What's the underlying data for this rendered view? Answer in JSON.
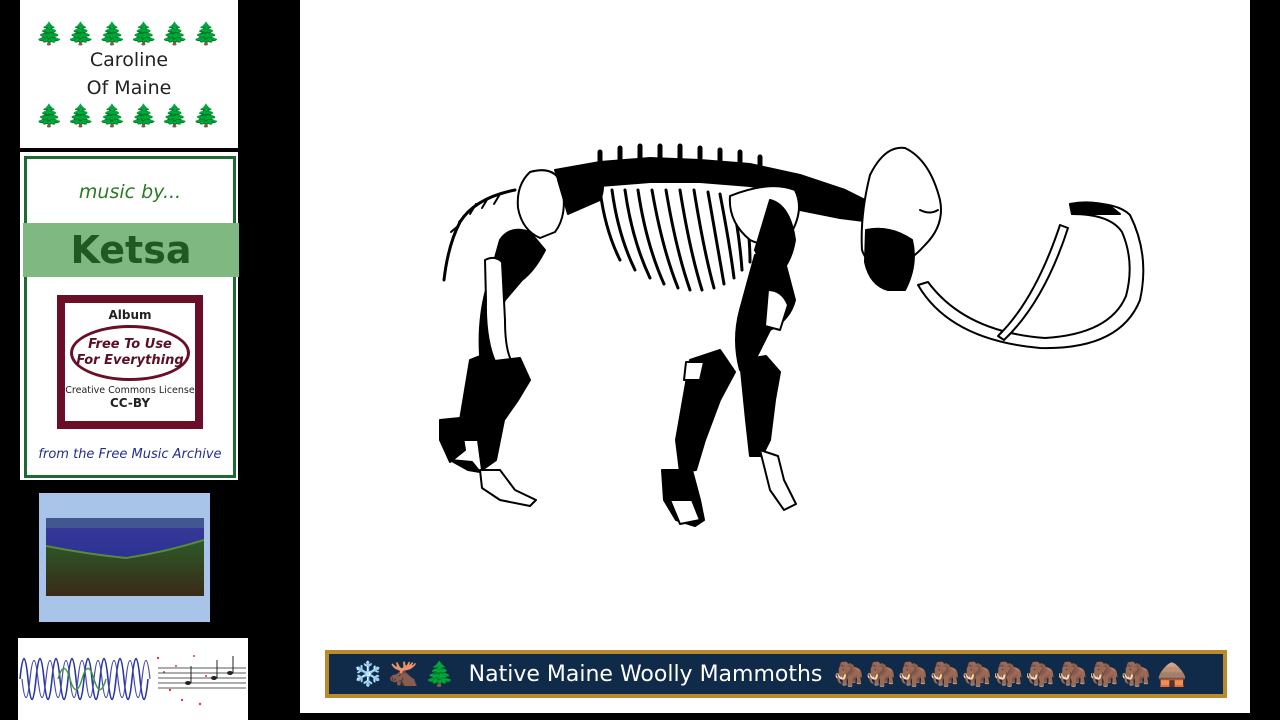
{
  "title_card": {
    "line1": "Caroline",
    "line2": "Of Maine",
    "tree_icon": "evergreen-tree-icon"
  },
  "music_card": {
    "music_by": "music by...",
    "artist": "Ketsa",
    "album_label": "Album",
    "album_name_line1": "Free To Use",
    "album_name_line2": "For Everything",
    "license_label": "Creative Commons License",
    "license_code": "CC-BY",
    "source": "from the Free Music Archive",
    "colors": {
      "accent": "#1d6a32",
      "band": "#7fb881",
      "album": "#6a0f27"
    }
  },
  "caption": {
    "text": "Native Maine Woolly Mammoths",
    "left_icons": [
      "snowflake-icon",
      "moose-icon",
      "evergreen-tree-icon"
    ],
    "mammoth_count": 10,
    "right_icon": "hut-icon",
    "colors": {
      "border": "#b88a2b",
      "background": "#102a4a"
    }
  }
}
